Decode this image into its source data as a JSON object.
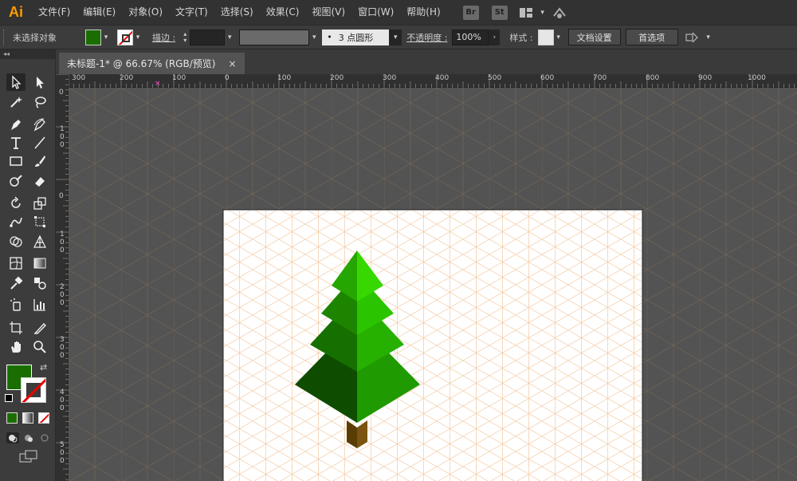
{
  "app": {
    "logo": "Ai"
  },
  "menu": [
    "文件(F)",
    "编辑(E)",
    "对象(O)",
    "文字(T)",
    "选择(S)",
    "效果(C)",
    "视图(V)",
    "窗口(W)",
    "帮助(H)"
  ],
  "bridge_badges": [
    "Br",
    "St"
  ],
  "control": {
    "selection_state": "未选择对象",
    "fill_color": "#1a6e00",
    "stroke_label": "描边 :",
    "brush_label": "3 点圆形",
    "opacity_label": "不透明度 :",
    "opacity_value": "100%",
    "style_label": "样式 :",
    "doc_setup_button": "文档设置",
    "preferences_button": "首选项"
  },
  "toolbar": {
    "header": "◂◂"
  },
  "document_tab": {
    "title": "未标题-1* @ 66.67% (RGB/预览)",
    "close": "×"
  },
  "ruler": {
    "h_labels": [
      "300",
      "200",
      "100",
      "0",
      "100",
      "200",
      "300",
      "400",
      "500",
      "600",
      "700",
      "800",
      "900",
      "1000"
    ],
    "v_labels": [
      "0",
      "100",
      "0",
      "100",
      "200",
      "300",
      "400",
      "500"
    ],
    "pink_marker": "×"
  },
  "colors": {
    "tree_light": "#35d400",
    "tree_mid": "#1f9e00",
    "tree_dark": "#0e4d00",
    "trunk": "#6b4a0a",
    "grid_line": "#f4c9a4",
    "canvas_bg": "#535353"
  }
}
